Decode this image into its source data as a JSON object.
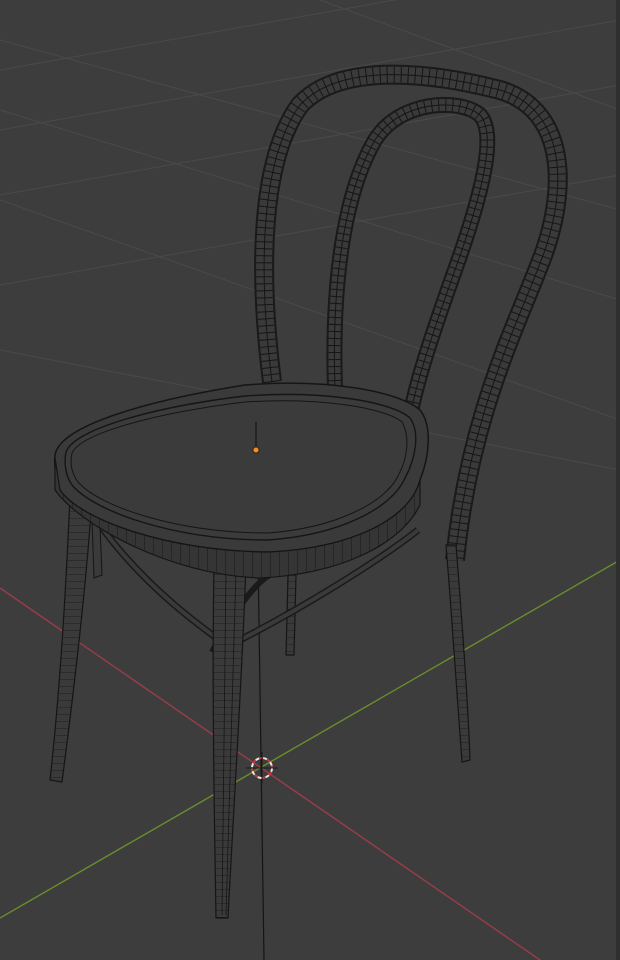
{
  "app": "3d-viewport",
  "viewport": {
    "background_color": "#3d3d3d",
    "grid_line_color": "#4a4a4a",
    "x_axis_color": "#9c3c4a",
    "y_axis_color": "#6a8e2b",
    "wire_color": "#151515",
    "origin_color": "#ff8c1a"
  },
  "scene": {
    "object": "chair",
    "display_mode": "wireframe",
    "icons": [
      "3d-cursor-icon",
      "object-origin-icon"
    ]
  }
}
